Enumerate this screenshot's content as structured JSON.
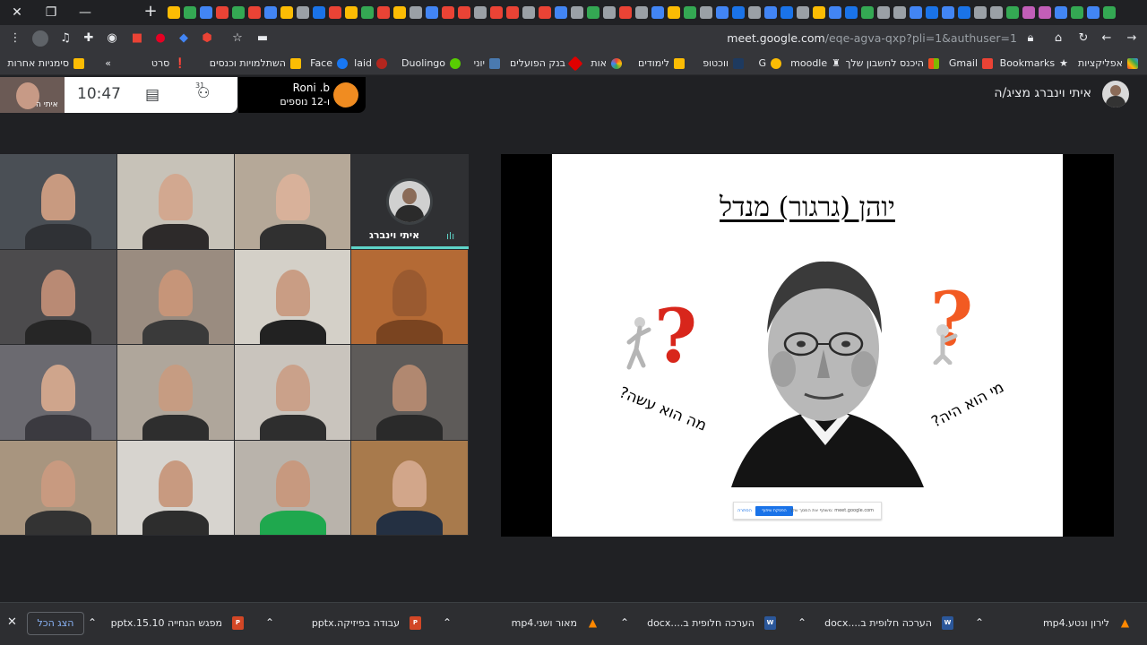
{
  "window": {
    "close_label": "✕",
    "restore_label": "❐",
    "minimize_label": "—",
    "new_tab_label": "+"
  },
  "tab_favicon_colors": [
    "#fbbc04",
    "#34a853",
    "#4285f4",
    "#ea4335",
    "#34a853",
    "#ea4335",
    "#4285f4",
    "#fbbc04",
    "#9aa0a6",
    "#1a73e8",
    "#ea4335",
    "#fbbc04",
    "#34a853",
    "#ea4335",
    "#fbbc04",
    "#9aa0a6",
    "#4285f4",
    "#ea4335",
    "#ea4335",
    "#9aa0a6",
    "#ea4335",
    "#ea4335",
    "#9aa0a6",
    "#ea4335",
    "#4285f4",
    "#9aa0a6",
    "#34a853",
    "#9aa0a6",
    "#ea4335",
    "#9aa0a6",
    "#4285f4",
    "#fbbc04",
    "#34a853",
    "#9aa0a6",
    "#4285f4",
    "#1a73e8",
    "#9aa0a6",
    "#4285f4",
    "#1a73e8",
    "#9aa0a6",
    "#fbbc04",
    "#4285f4",
    "#1a73e8",
    "#34a853",
    "#9aa0a6",
    "#9aa0a6",
    "#4285f4",
    "#1a73e8",
    "#4285f4",
    "#1a73e8",
    "#9aa0a6",
    "#9aa0a6",
    "#34a853",
    "#c25eb8",
    "#c25eb8",
    "#4285f4",
    "#34a853",
    "#4285f4",
    "#34a853"
  ],
  "toolbar": {
    "url_host": "meet.google.com",
    "url_path": "/eqe-agva-qxp?pli=1&authuser=1"
  },
  "bookmarks": {
    "apps": "אפליקציות",
    "bookmarks": "Bookmarks",
    "gmail": "Gmail",
    "bank_login": "היכנס לחשבון שלך",
    "moodle": "moodle",
    "g": "G",
    "wakaf": "ווכטופ",
    "learning": "לימודים",
    "ot": "אות",
    "bank_hapoalim": "בנק הפועלים",
    "yoni": "יוני",
    "duolingo": "Duolingo",
    "laid": "laid",
    "face": "Face",
    "courses": "השתלמויות וכנסים",
    "seret": "סרט",
    "more": "»",
    "other_bookmarks": "סימניות אחרות"
  },
  "meeting": {
    "self_name": "איתי ה",
    "time": "10:47",
    "chat_icon": "▤",
    "people_icon": "⚇",
    "people_count": "31",
    "presenting_name": "Roni .b",
    "presenting_more": "ו-12 נוספים",
    "presenter_label": "איתי וינברג מציג/ה",
    "active_speaker_name": "איתי וינברג",
    "active_speaker_wave": "ılı"
  },
  "slide": {
    "title": "יוהן (גרגור) מנדל",
    "caption_left": "מה הוא עשה?",
    "caption_right": "מי הוא היה?",
    "share_text": "משתף את המסך שלך: meet.google.com",
    "share_button": "הפסקת שיתוף",
    "share_hide": "הסתרה"
  },
  "downloads": {
    "items": [
      {
        "name": "לירון ונטע.mp4",
        "type": "vlc"
      },
      {
        "name": "הערכה חלופית ב....docx",
        "type": "docx"
      },
      {
        "name": "הערכה חלופית ב....docx",
        "type": "docx"
      },
      {
        "name": "מאור ושני.mp4",
        "type": "vlc"
      },
      {
        "name": "עבודה בפיזיקה.pptx",
        "type": "pptx"
      },
      {
        "name": "מפגש הנחייה 15.10.pptx",
        "type": "pptx"
      }
    ],
    "show_all": "הצג הכל",
    "close": "✕"
  }
}
